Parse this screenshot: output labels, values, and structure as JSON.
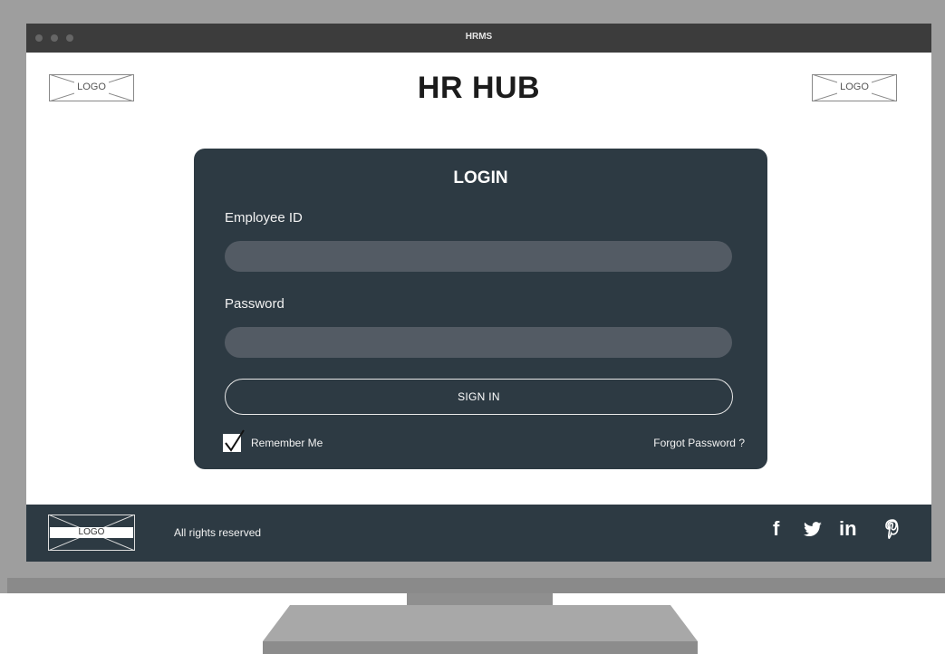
{
  "window": {
    "title": "HRMS"
  },
  "header": {
    "logo_left": "LOGO",
    "title": "HR HUB",
    "logo_right": "LOGO"
  },
  "login": {
    "heading": "LOGIN",
    "employee_id_label": "Employee ID",
    "employee_id_value": "",
    "password_label": "Password",
    "password_value": "",
    "sign_in_label": "SIGN IN",
    "remember_label": "Remember Me",
    "remember_checked": true,
    "forgot_label": "Forgot Password ?"
  },
  "footer": {
    "logo": "LOGO",
    "text": "All rights reserved",
    "social": [
      {
        "icon": "facebook-icon",
        "glyph": "f"
      },
      {
        "icon": "twitter-icon",
        "glyph": "🐦"
      },
      {
        "icon": "linkedin-icon",
        "glyph": "in"
      },
      {
        "icon": "pinterest-icon",
        "glyph": "P"
      }
    ]
  },
  "colors": {
    "dark_panel": "#2d3a43",
    "input_bg": "#535b64",
    "titlebar": "#3c3c3c"
  }
}
